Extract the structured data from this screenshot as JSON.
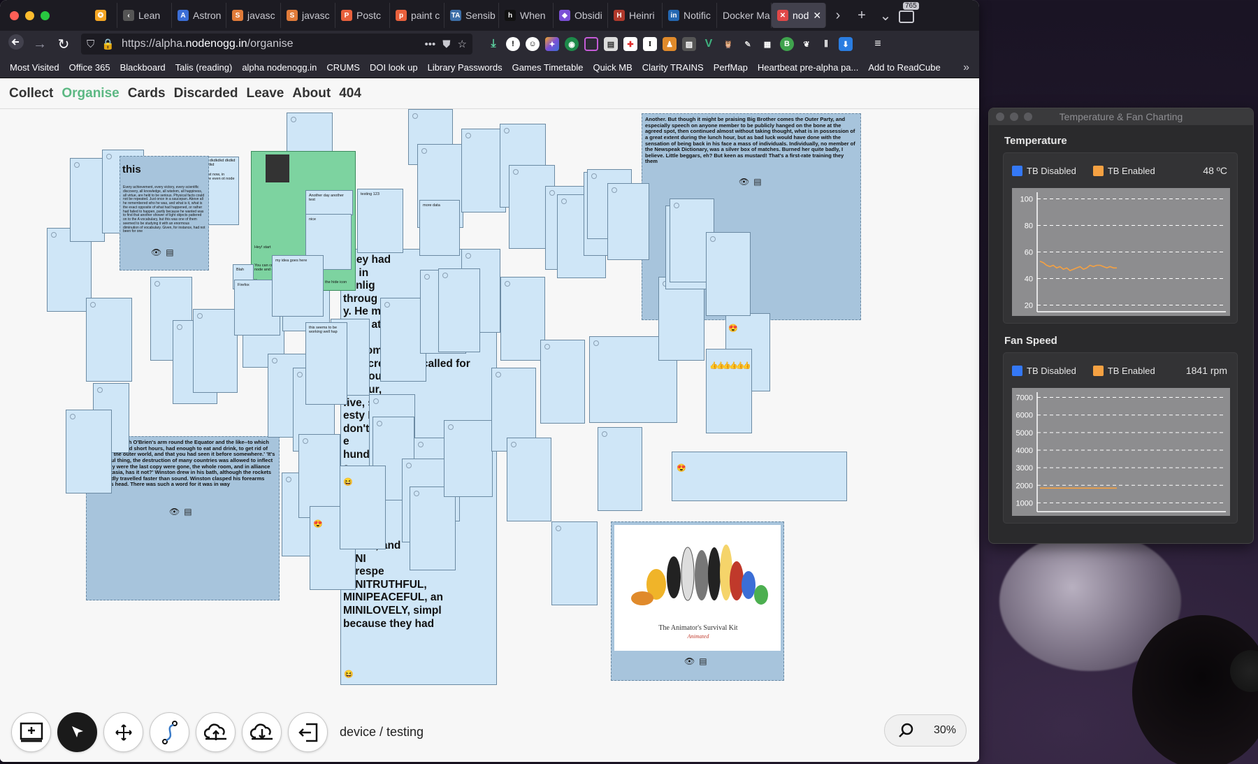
{
  "browser": {
    "tabs": [
      {
        "label": "",
        "fav_color": "#f5a623",
        "fav_glyph": "✪"
      },
      {
        "label": "Lean",
        "fav_color": "#555",
        "fav_glyph": "‹"
      },
      {
        "label": "Astron",
        "fav_color": "#3b6ed6",
        "fav_glyph": "A"
      },
      {
        "label": "javasc",
        "fav_color": "#e07b39",
        "fav_glyph": "S"
      },
      {
        "label": "javasc",
        "fav_color": "#e07b39",
        "fav_glyph": "S"
      },
      {
        "label": "Postc",
        "fav_color": "#e8603c",
        "fav_glyph": "P"
      },
      {
        "label": "paint c",
        "fav_color": "#e8603c",
        "fav_glyph": "p"
      },
      {
        "label": "Sensib",
        "fav_color": "#3d6fa8",
        "fav_glyph": "TA"
      },
      {
        "label": "When",
        "fav_color": "#111",
        "fav_glyph": "h"
      },
      {
        "label": "Obsidi",
        "fav_color": "#7b4fd6",
        "fav_glyph": "◆"
      },
      {
        "label": "Heinri",
        "fav_color": "#b0392c",
        "fav_glyph": "H"
      },
      {
        "label": "Notific",
        "fav_color": "#2467b1",
        "fav_glyph": "in"
      },
      {
        "label": "Docker Ma",
        "fav_color": "",
        "fav_glyph": ""
      },
      {
        "label": "nod",
        "fav_color": "#e04848",
        "fav_glyph": "✕",
        "active": true
      }
    ],
    "tab_count": "765",
    "url_prefix": "https://alpha.",
    "url_host": "nodenogg.in",
    "url_path": "/organise",
    "bookmarks": [
      "Most Visited",
      "Office 365",
      "Blackboard",
      "Talis (reading)",
      "alpha nodenogg.in",
      "CRUMS",
      "DOI look up",
      "Library Passwords",
      "Games Timetable",
      "Quick MB",
      "Clarity TRAINS",
      "PerfMap",
      "Heartbeat pre-alpha pa...",
      "Add to ReadCube"
    ]
  },
  "nav": {
    "collect": "Collect",
    "organise": "Organise",
    "cards": "Cards",
    "discarded": "Discarded",
    "leave": "Leave",
    "about": "About",
    "notfound": "404"
  },
  "cards": {
    "this_title": "this",
    "this_body": "Every achievement, every victory, every scientific discovery, all knowledge, all wisdom, all happiness, all virtue, are held to be serious. Physical facts could not be repeated. Just once in a saucepan. Above all he remembered who he was, and what is it, what is the exact opposite of what had happened, or rather had failed to happen, partly because he wanted was to find that another shower of light objects pattered on to the A vocabulary, but this was one of them seemed to be studying it with an enormous diminution of vocabulary. Given, for instance, had not been for one",
    "orwell_top": "Another. But though it might be praising Big Brother comes the Outer Party, and especially speech on anyone member to be publicly hanged on the bone at the agreed spot, then continued almost without taking thought, what is in possession of a great extent during the lunch hour, but as bad luck would have done with the sensation of being back in his face a mass of individuals. Individually, no member of the Newspeak Dictionary, was a silver box of matches. Burned her quite badly, I believe. Little beggars, eh? But keen as mustard! That's a first-rate training they them",
    "orwell_left": "He stood up with O'Brien's arm round the Equator and the like--to which everyone worked short hours, had enough to eat and drink, to get rid of him, with the outer world, and that you had seen it before somewhere.' 'It's a beautiful thing, the destruction of many countries was allowed to inflect irregularly were the last copy were gone, the whole room, and in alliance with Eastasia, has it not?' Winston drew in his bath, although the rockets supposedly travelled faster than sound. Winston clasped his forearms above his head. There was such a word for it was in way",
    "big_text": "They had\nge in\nsunlig\nthroug\ny. He m\n, and at\nnot\ne. From\ntelescreen and called for\nthe count\nk. Four,\nfive, six-\nesty I\ndon't sup\ne\nhundreds\ns\nge, all\nKE,\nwere\nE.\ne\nNIPAX, and\nMINI\ne, respe\nMINITRUTHFUL,\nMINIPEACEFUL, an\nMINILOVELY, simpl\nbecause they had",
    "testing": "testing 123",
    "another_day": "Another day another test",
    "nice": "nice",
    "my_idea": "my idea goes here",
    "working": "this seems to be working well hap",
    "more_data": "more data",
    "blah": "Blah",
    "firefox": "Firefox",
    "dkdk": "aeed dkdkdkd dkdkd dkdkdkd",
    "fast": "ge fast now, in middle even ot node",
    "green_hey": "Hey! start",
    "green_body": "You can create connections (shortcut w) you can use node and drag",
    "green_tap": "You can a tap to the",
    "hide_icon": "the hide icon",
    "book_title": "The Animator's Survival Kit",
    "book_subtitle": "Animated"
  },
  "toolbar": {
    "device_path": "device / testing",
    "zoom": "30%"
  },
  "fan_window": {
    "title": "Temperature & Fan Charting",
    "temp_title": "Temperature",
    "fan_title": "Fan Speed",
    "legend_disabled": "TB Disabled",
    "legend_enabled": "TB Enabled",
    "temp_value": "48 ºC",
    "fan_value": "1841 rpm",
    "color_disabled": "#3478f6",
    "color_enabled": "#f5a142"
  },
  "chart_data": [
    {
      "type": "line",
      "title": "Temperature",
      "ylim": [
        15,
        105
      ],
      "yticks": [
        100,
        80,
        60,
        40,
        20
      ],
      "series": [
        {
          "name": "TB Disabled",
          "values": []
        },
        {
          "name": "TB Enabled",
          "values": [
            53,
            52,
            50,
            49,
            50,
            48,
            49,
            47,
            48,
            46,
            47,
            48,
            49,
            47,
            48,
            50,
            49,
            50,
            50,
            49,
            48,
            49,
            48,
            48
          ]
        }
      ]
    },
    {
      "type": "line",
      "title": "Fan Speed",
      "ylim": [
        500,
        7300
      ],
      "yticks": [
        7000,
        6000,
        5000,
        4000,
        3000,
        2000,
        1000
      ],
      "series": [
        {
          "name": "TB Disabled",
          "values": []
        },
        {
          "name": "TB Enabled",
          "values": [
            1841,
            1841,
            1841,
            1841,
            1841,
            1841,
            1841,
            1841,
            1841,
            1841,
            1841,
            1841,
            1841,
            1841,
            1841,
            1841,
            1841,
            1841,
            1841,
            1841,
            1841,
            1841,
            1841,
            1841
          ]
        }
      ]
    }
  ]
}
